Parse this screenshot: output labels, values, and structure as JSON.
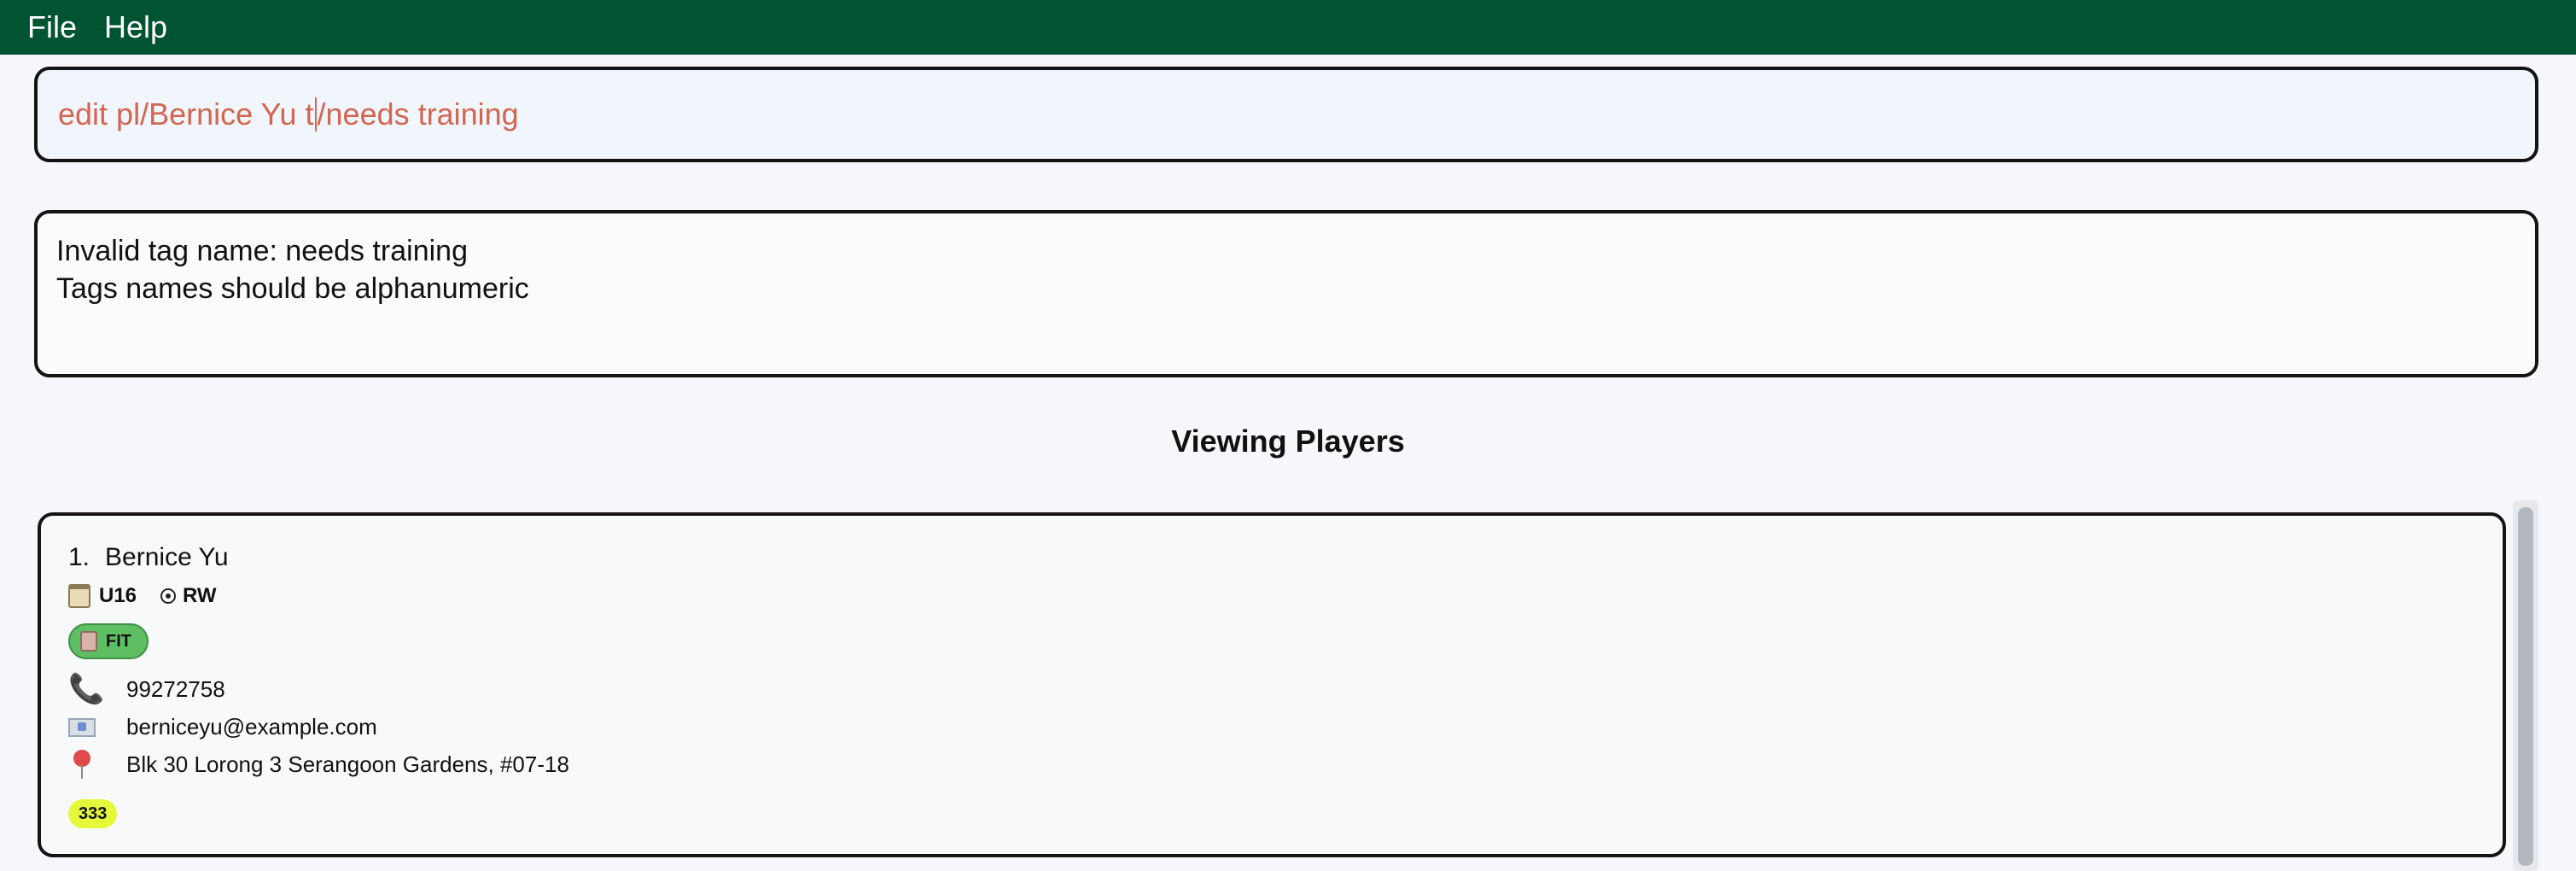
{
  "menu": {
    "file_label": "File",
    "help_label": "Help"
  },
  "command": {
    "text_before_caret": "edit pl/Bernice Yu t",
    "text_after_caret": "/needs training"
  },
  "result": {
    "line1": "Invalid tag name: needs training",
    "line2": "Tags names should be alphanumeric"
  },
  "list": {
    "title": "Viewing Players",
    "players": [
      {
        "index": "1.",
        "name": "Bernice Yu",
        "age_group": "U16",
        "position": "RW",
        "status": "FIT",
        "phone": "99272758",
        "email": "berniceyu@example.com",
        "address": "Blk 30 Lorong 3 Serangoon Gardens, #07-18",
        "tag": "333"
      }
    ]
  },
  "colors": {
    "menubar": "#005431",
    "command_text": "#d26650",
    "fit_badge": "#5dbf62",
    "tag_badge": "#e6f83a"
  },
  "icons": {
    "age_group": "calendar-icon",
    "position": "soccer-ball-icon",
    "status": "fitness-icon",
    "phone": "phone-icon",
    "email": "email-icon",
    "address": "location-pin-icon"
  }
}
